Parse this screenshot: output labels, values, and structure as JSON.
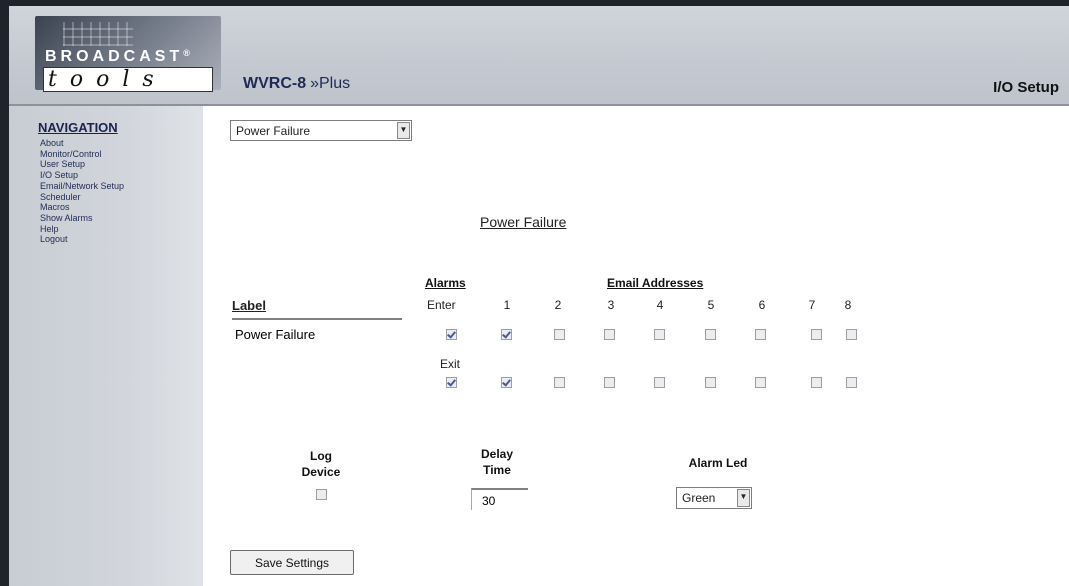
{
  "header": {
    "logo_top": "BROADCAST",
    "logo_trademark": "®",
    "logo_bottom": "tools",
    "product_name": "WVRC-8",
    "product_plus": "»Plus",
    "page_title": "I/O Setup"
  },
  "sidebar": {
    "title": "NAVIGATION",
    "items": [
      {
        "label": "About"
      },
      {
        "label": "Monitor/Control"
      },
      {
        "label": "User Setup"
      },
      {
        "label": "I/O Setup"
      },
      {
        "label": "Email/Network Setup"
      },
      {
        "label": "Scheduler"
      },
      {
        "label": "Macros"
      },
      {
        "label": "Show Alarms"
      },
      {
        "label": "Help"
      },
      {
        "label": "Logout"
      }
    ]
  },
  "io_select": {
    "value": "Power Failure"
  },
  "section_title": "Power Failure",
  "grid": {
    "alarms_header": "Alarms",
    "email_header": "Email Addresses",
    "label_header": "Label",
    "label_value": "Power Failure",
    "enter_label": "Enter",
    "exit_label": "Exit",
    "columns": [
      "1",
      "2",
      "3",
      "4",
      "5",
      "6",
      "7",
      "8"
    ],
    "enter_alarm_checked": true,
    "exit_alarm_checked": true,
    "enter_emails_checked": [
      true,
      false,
      false,
      false,
      false,
      false,
      false,
      false
    ],
    "exit_emails_checked": [
      true,
      false,
      false,
      false,
      false,
      false,
      false,
      false
    ]
  },
  "options": {
    "log_device_line1": "Log",
    "log_device_line2": "Device",
    "log_device_checked": false,
    "delay_time_line1": "Delay",
    "delay_time_line2": "Time",
    "delay_time_value": "30",
    "alarm_led_label": "Alarm Led",
    "alarm_led_value": "Green"
  },
  "buttons": {
    "save_label": "Save Settings"
  },
  "colors": {
    "header_bg": "#c8ccd3",
    "nav_text": "#1e2b55",
    "frame": "#20232c"
  }
}
